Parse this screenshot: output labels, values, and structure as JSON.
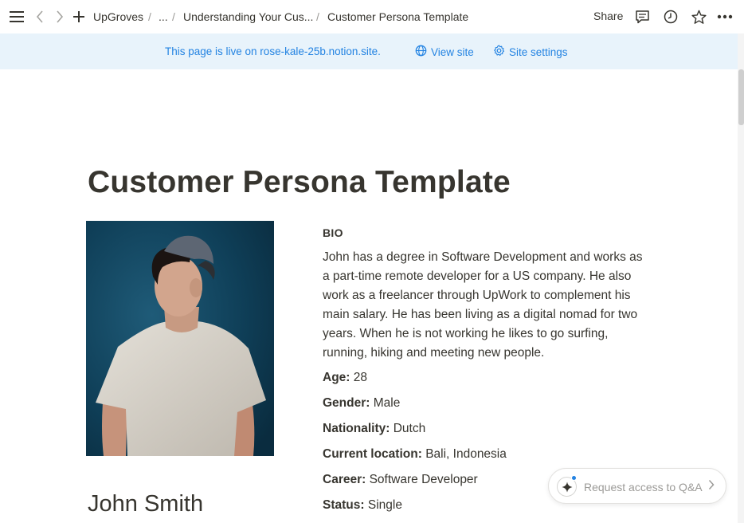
{
  "topbar": {
    "menu_icon": "hamburger-icon",
    "back_icon": "chevron-left-icon",
    "forward_icon": "chevron-right-icon",
    "new_icon": "plus-icon",
    "breadcrumbs": [
      "UpGroves",
      "...",
      "Understanding Your Cus...",
      "Customer Persona Template"
    ],
    "separator": "/",
    "share_label": "Share",
    "comments_icon": "comment-icon",
    "history_icon": "clock-icon",
    "favorite_icon": "star-icon",
    "more_icon": "more-icon"
  },
  "banner": {
    "text": "This page is live on rose-kale-25b.notion.site.",
    "view_site": "View site",
    "site_settings": "Site settings",
    "accent": "#2383e2",
    "background": "#e8f3fb"
  },
  "page": {
    "title": "Customer Persona Template",
    "name": "John Smith",
    "bio_heading": "BIO",
    "bio_lines": [
      "John has a degree in Software Development and works as",
      "a part-time remote developer for a US company. He also",
      "work as a freelancer through UpWork to complement his",
      "main salary. He has been living as a digital nomad for two",
      "years. When he is not working he likes to go surfing,",
      "running, hiking and meeting new people."
    ],
    "fields": [
      {
        "label": "Age:",
        "value": "28"
      },
      {
        "label": "Gender:",
        "value": "Male"
      },
      {
        "label": "Nationality:",
        "value": "Dutch"
      },
      {
        "label": "Current location:",
        "value": "Bali, Indonesia"
      },
      {
        "label": "Career:",
        "value": "Software Developer"
      },
      {
        "label": "Status:",
        "value": "Single"
      }
    ]
  },
  "qa": {
    "label": "Request access to Q&A",
    "icon": "sparkle-icon"
  }
}
